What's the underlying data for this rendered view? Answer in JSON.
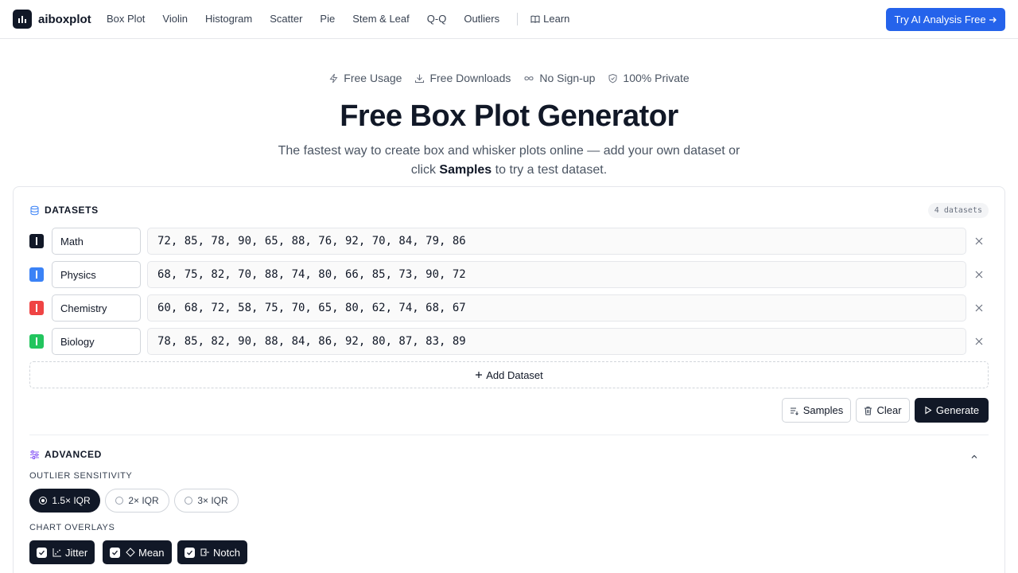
{
  "nav": {
    "logo_text": "aiboxplot",
    "links": [
      "Box Plot",
      "Violin",
      "Histogram",
      "Scatter",
      "Pie",
      "Stem & Leaf",
      "Q-Q",
      "Outliers"
    ],
    "learn_label": "Learn",
    "cta_label": "Try AI Analysis Free",
    "cta_color": "#2563eb"
  },
  "hero": {
    "badges": [
      {
        "icon": "bolt-icon",
        "label": "Free Usage"
      },
      {
        "icon": "download-icon",
        "label": "Free Downloads"
      },
      {
        "icon": "infinity-icon",
        "label": "No Sign-up"
      },
      {
        "icon": "shield-icon",
        "label": "100% Private"
      }
    ],
    "title": "Free Box Plot Generator",
    "subtitle_pre": "The fastest way to create box and whisker plots online — add your own dataset or click ",
    "subtitle_bold": "Samples",
    "subtitle_post": " to try a test dataset."
  },
  "datasets_section": {
    "title": "DATASETS",
    "count_label": "4 datasets",
    "items": [
      {
        "name": "Math",
        "values": "72, 85, 78, 90, 65, 88, 76, 92, 70, 84, 79, 86",
        "color": "#111827"
      },
      {
        "name": "Physics",
        "values": "68, 75, 82, 70, 88, 74, 80, 66, 85, 73, 90, 72",
        "color": "#3b82f6"
      },
      {
        "name": "Chemistry",
        "values": "60, 68, 72, 58, 75, 70, 65, 80, 62, 74, 68, 67",
        "color": "#ef4444"
      },
      {
        "name": "Biology",
        "values": "78, 85, 82, 90, 88, 84, 86, 92, 80, 87, 83, 89",
        "color": "#22c55e"
      }
    ],
    "add_label": "Add Dataset",
    "samples_label": "Samples",
    "clear_label": "Clear",
    "generate_label": "Generate"
  },
  "advanced": {
    "title": "ADVANCED",
    "outlier_label": "OUTLIER SENSITIVITY",
    "outlier_options": [
      {
        "label": "1.5× IQR",
        "selected": true
      },
      {
        "label": "2× IQR",
        "selected": false
      },
      {
        "label": "3× IQR",
        "selected": false
      }
    ],
    "overlays_label": "CHART OVERLAYS",
    "overlays": [
      {
        "label": "Jitter",
        "checked": true
      },
      {
        "label": "Mean",
        "checked": true
      },
      {
        "label": "Notch",
        "checked": true
      }
    ]
  }
}
